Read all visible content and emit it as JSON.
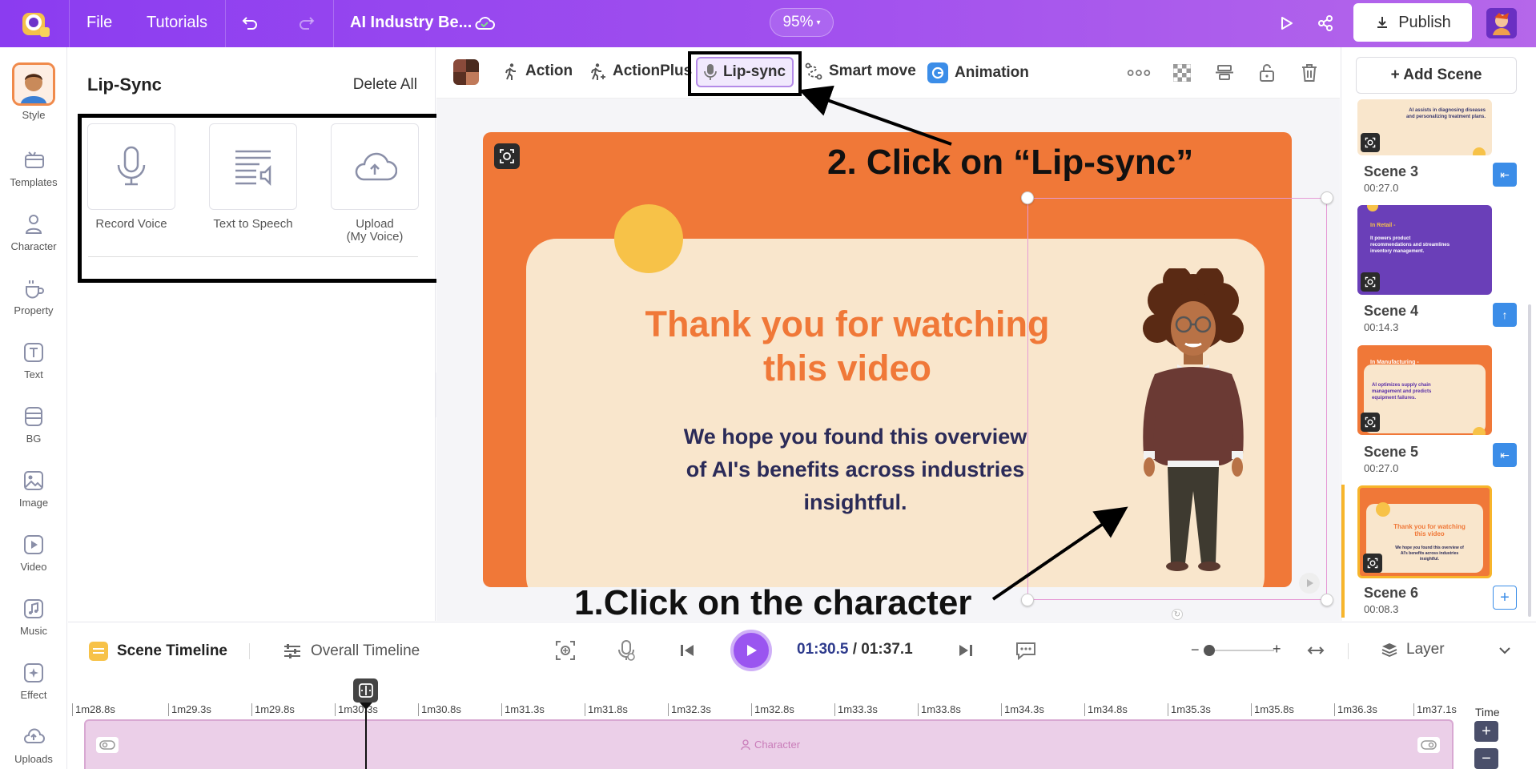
{
  "topbar": {
    "file": "File",
    "tutorials": "Tutorials",
    "project_title": "AI Industry Be...",
    "zoom": "95%",
    "publish": "Publish"
  },
  "left_nav": [
    "Style",
    "Templates",
    "Character",
    "Property",
    "Text",
    "BG",
    "Image",
    "Video",
    "Music",
    "Effect",
    "Uploads"
  ],
  "panel": {
    "title": "Lip-Sync",
    "delete_all": "Delete All",
    "options": [
      "Record Voice",
      "Text to Speech",
      "Upload"
    ],
    "upload_sub": "(My Voice)"
  },
  "toolbar": {
    "action": "Action",
    "actionplus": "ActionPlus",
    "lipsync": "Lip-sync",
    "smart_move": "Smart move",
    "animation": "Animation"
  },
  "slide": {
    "title": "Thank you for watching this video",
    "subtitle": "We hope you found this overview of AI's benefits across industries insightful."
  },
  "annotations": {
    "step1": "1.Click on the character",
    "step2": "2. Click on “Lip-sync”"
  },
  "scenes": {
    "add": "+ Add Scene",
    "items": [
      {
        "name": "Scene 3",
        "time": "00:27.0",
        "thumb_text": "AI assists in diagnosing diseases and personalizing treatment plans."
      },
      {
        "name": "Scene 4",
        "time": "00:14.3",
        "thumb_title": "In Retail -",
        "thumb_text": "It powers product recommendations and streamlines inventory management."
      },
      {
        "name": "Scene 5",
        "time": "00:27.0",
        "thumb_title": "In Manufacturing -",
        "thumb_text": "AI optimizes supply chain management and predicts equipment failures."
      },
      {
        "name": "Scene 6",
        "time": "00:08.3",
        "thumb_title": "Thank you for watching this video",
        "thumb_text": "We hope you found this overview of AI's benefits across industries insightful."
      }
    ]
  },
  "timeline": {
    "scene_tab": "Scene Timeline",
    "overall_tab": "Overall Timeline",
    "current": "01:30.5",
    "separator": "/",
    "total": "01:37.1",
    "layer": "Layer",
    "time_label": "Time",
    "track_label": "Character",
    "ticks": [
      "1m28.8s",
      "1m29.3s",
      "1m29.8s",
      "1m30.3s",
      "1m30.8s",
      "1m31.3s",
      "1m31.8s",
      "1m32.3s",
      "1m32.8s",
      "1m33.3s",
      "1m33.8s",
      "1m34.3s",
      "1m34.8s",
      "1m35.3s",
      "1m35.8s",
      "1m36.3s",
      "1m37.1s"
    ]
  },
  "colors": {
    "brand_purple": "#9a55f0",
    "slide_orange": "#f07838",
    "slide_cream": "#f9e6cc",
    "slide_navy": "#2b2b58",
    "scene_blue": "#3b8de8"
  }
}
